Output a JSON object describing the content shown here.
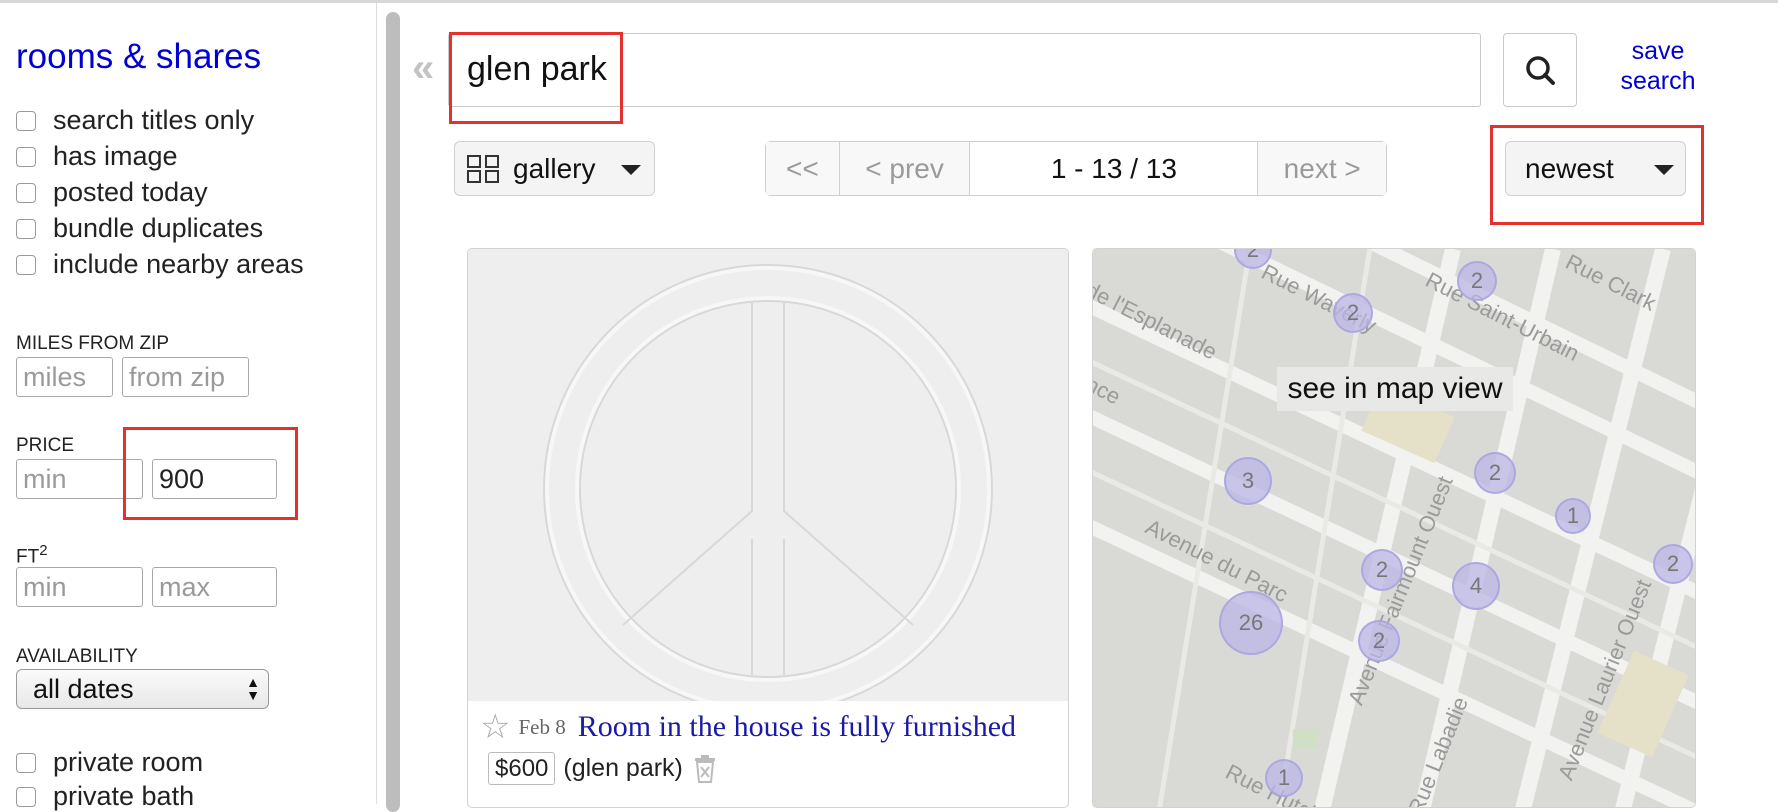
{
  "sidebar": {
    "title": "rooms & shares",
    "options": [
      {
        "label": "search titles only"
      },
      {
        "label": "has image"
      },
      {
        "label": "posted today"
      },
      {
        "label": "bundle duplicates"
      },
      {
        "label": "include nearby areas"
      }
    ],
    "miles_label": "MILES FROM ZIP",
    "miles_placeholder": "miles",
    "zip_placeholder": "from zip",
    "price_label": "PRICE",
    "price_min_placeholder": "min",
    "price_max_value": "900",
    "ft_label": "FT",
    "ft_sup": "2",
    "ft_min_placeholder": "min",
    "ft_max_placeholder": "max",
    "availability_label": "AVAILABILITY",
    "availability_value": "all dates",
    "room_options": [
      {
        "label": "private room"
      },
      {
        "label": "private bath"
      }
    ]
  },
  "search": {
    "collapse_glyph": "«",
    "query": "glen park",
    "save_line1": "save",
    "save_line2": "search"
  },
  "toolbar": {
    "view_label": "gallery",
    "first": "<<",
    "prev": "< prev",
    "range": "1 - 13 / 13",
    "next": "next >",
    "sort_label": "newest"
  },
  "listing": {
    "date": "Feb 8",
    "title": "Room in the house is fully furnished",
    "price": "$600",
    "hood": "(glen park)"
  },
  "map": {
    "caption": "see in map view",
    "streets": [
      "Rue Waverly",
      "Rue Saint-Urbain",
      "Rue Clark",
      "Avenue du Parc",
      "Avenue Fairmount Ouest",
      "Avenue Laurier Ouest",
      "Rue Hutchison",
      "Rue Labadie",
      "de l'Esplanade",
      "nce"
    ],
    "clusters": [
      "2",
      "2",
      "2",
      "3",
      "2",
      "1",
      "2",
      "4",
      "26",
      "2",
      "2",
      "1"
    ]
  },
  "colors": {
    "link": "#0000d5",
    "highlight": "#e4312d",
    "cluster": "#bab6e6"
  }
}
